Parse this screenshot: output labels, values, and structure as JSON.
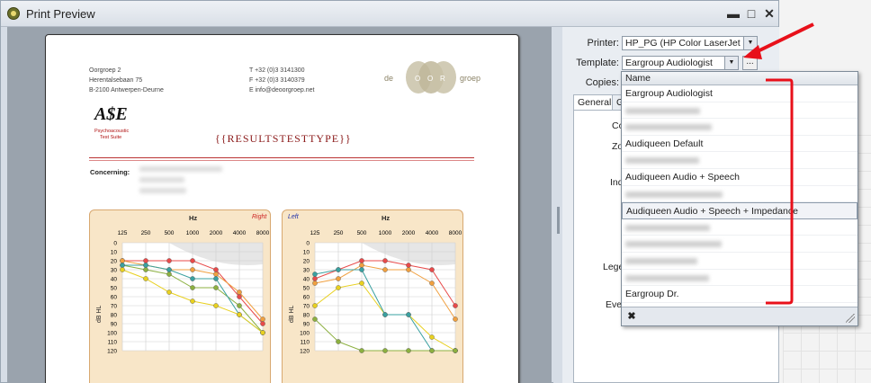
{
  "window": {
    "title": "Print Preview",
    "minimize_glyph": "▬",
    "maximize_glyph": "□",
    "close_glyph": "✕"
  },
  "document": {
    "address_left": "Oorgroep 2\nHerentalsebaan 75\nB-2100 Antwerpen-Deurne",
    "address_right": "T +32 (0)3 3141300\nF +32 (0)3 3140379\nE info@deoorgroep.net",
    "brand_text_left": "de",
    "brand_text_mid1": "O",
    "brand_text_mid2": "O",
    "brand_text_mid3": "R",
    "brand_text_right": "groep",
    "ase_logo": "A$E",
    "ase_sub1": "Psychoacoustic",
    "ase_sub2": "Test Suite",
    "report_title": "{{RESULTSTESTTYPE}}",
    "concerning_label": "Concerning:",
    "audiogram_right": {
      "title_unit": "Hz",
      "side": "Right",
      "side_color": "#cc2222",
      "freqs": [
        "125",
        "250",
        "500",
        "1000",
        "2000",
        "4000",
        "8000"
      ],
      "db_ticks": [
        "0",
        "10",
        "20",
        "30",
        "40",
        "50",
        "60",
        "70",
        "80",
        "90",
        "100",
        "110",
        "120"
      ],
      "ylabel": "dB HL"
    },
    "audiogram_left": {
      "title_unit": "Hz",
      "side": "Left",
      "side_color": "#2233aa",
      "freqs": [
        "125",
        "250",
        "500",
        "1000",
        "2000",
        "4000",
        "8000"
      ],
      "db_ticks": [
        "0",
        "10",
        "20",
        "30",
        "40",
        "50",
        "60",
        "70",
        "80",
        "90",
        "100",
        "110",
        "120"
      ],
      "ylabel": "dB HL"
    }
  },
  "panel": {
    "printer_label": "Printer:",
    "printer_value": "HP_PG (HP Color LaserJet M...",
    "template_label": "Template:",
    "template_value": "Eargroup Audiologist",
    "browse_label": "...",
    "copies_label": "Copies:",
    "tab_general": "General",
    "tab_graph": "Gr",
    "side_labels": [
      "Co",
      "Zo",
      "Ind",
      "Lege",
      "Ever"
    ]
  },
  "dropdown": {
    "header": "Name",
    "items": [
      {
        "label": "Eargroup Audiologist",
        "blurred": false
      },
      {
        "label": "",
        "blurred": true
      },
      {
        "label": "",
        "blurred": true
      },
      {
        "label": "Audiqueen Default",
        "blurred": false
      },
      {
        "label": "",
        "blurred": true
      },
      {
        "label": "Audiqueen Audio + Speech",
        "blurred": false
      },
      {
        "label": "",
        "blurred": true
      },
      {
        "label": "Audiqueen Audio + Speech + Impedance",
        "blurred": false,
        "selected": true
      },
      {
        "label": "",
        "blurred": true
      },
      {
        "label": "",
        "blurred": true
      },
      {
        "label": "",
        "blurred": true
      },
      {
        "label": "",
        "blurred": true
      },
      {
        "label": "Eargroup Dr.",
        "blurred": false
      }
    ],
    "close_glyph": "✖"
  },
  "colors": {
    "annotation_red": "#e8101a",
    "report_title": "#8b1a1a",
    "audiogram_bg": "#f8e6c8"
  }
}
